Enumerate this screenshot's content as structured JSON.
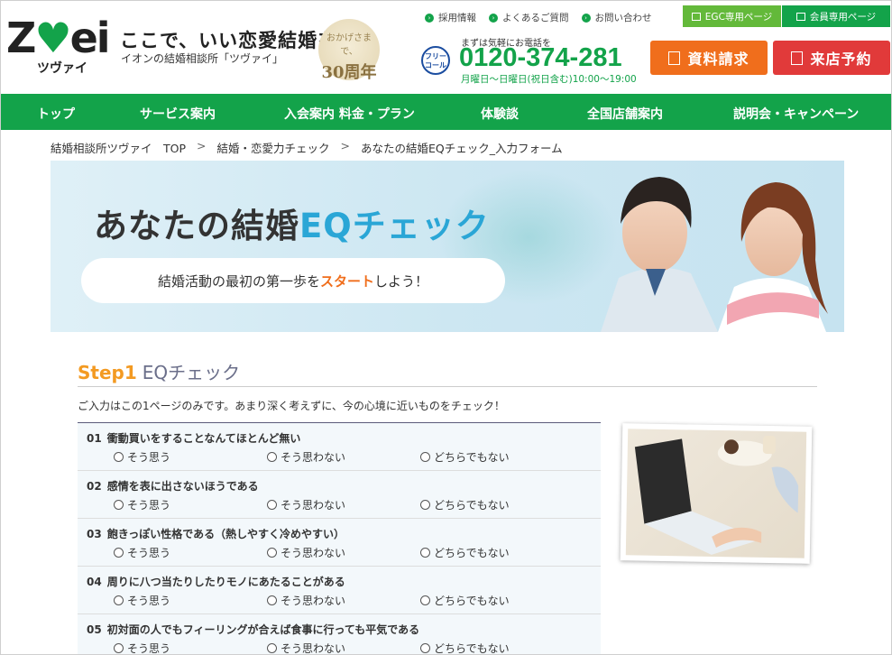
{
  "header": {
    "logo_text": "ZWEI",
    "logo_kana": "ツヴァイ",
    "tagline": "ここで、いい恋愛結婚を。",
    "subtag": "イオンの結婚相談所「ツヴァイ」",
    "anniv_top": "おかげさまで、",
    "anniv_num": "30周年",
    "toplinks": [
      "採用情報",
      "よくあるご質問",
      "お問い合わせ"
    ],
    "phone_icon": "フリーコール",
    "phone_pre": "まずは気軽にお電話を",
    "phone_num": "0120-374-281",
    "phone_hours": "月曜日〜日曜日(祝日含む)10:00〜19:00",
    "tab_egc": "EGC専用ページ",
    "tab_member": "会員専用ページ",
    "cta_request": "資料請求",
    "cta_visit": "来店予約"
  },
  "nav": {
    "items": [
      "トップ",
      "サービス案内",
      "入会案内 料金・プラン",
      "体験談",
      "全国店舗案内",
      "説明会・キャンペーン"
    ]
  },
  "breadcrumb": {
    "items": [
      "結婚相談所ツヴァイ　TOP",
      "結婚・恋愛力チェック",
      "あなたの結婚EQチェック_入力フォーム"
    ],
    "sep": ">"
  },
  "hero": {
    "title_pre": "あなたの結婚",
    "title_accent": "EQチェック",
    "pill_pre": "結婚活動の最初の第一歩を",
    "pill_hl": "スタート",
    "pill_post": "しよう！"
  },
  "step": {
    "label": "Step1",
    "sub": "EQチェック",
    "desc": "ご入力はこの1ページのみです。あまり深く考えずに、今の心境に近いものをチェック！"
  },
  "options": [
    "そう思う",
    "そう思わない",
    "どちらでもない"
  ],
  "questions": [
    {
      "num": "01",
      "text": "衝動買いをすることなんてほとんど無い"
    },
    {
      "num": "02",
      "text": "感情を表に出さないほうである"
    },
    {
      "num": "03",
      "text": "飽きっぽい性格である（熱しやすく冷めやすい）"
    },
    {
      "num": "04",
      "text": "周りに八つ当たりしたりモノにあたることがある"
    },
    {
      "num": "05",
      "text": "初対面の人でもフィーリングが合えば食事に行っても平気である"
    }
  ],
  "colors": {
    "brand_green": "#13a34a",
    "cta_orange": "#f06e1c",
    "cta_red": "#e13a3a",
    "step_orange": "#f39a22",
    "hero_accent": "#2aa6d6"
  }
}
